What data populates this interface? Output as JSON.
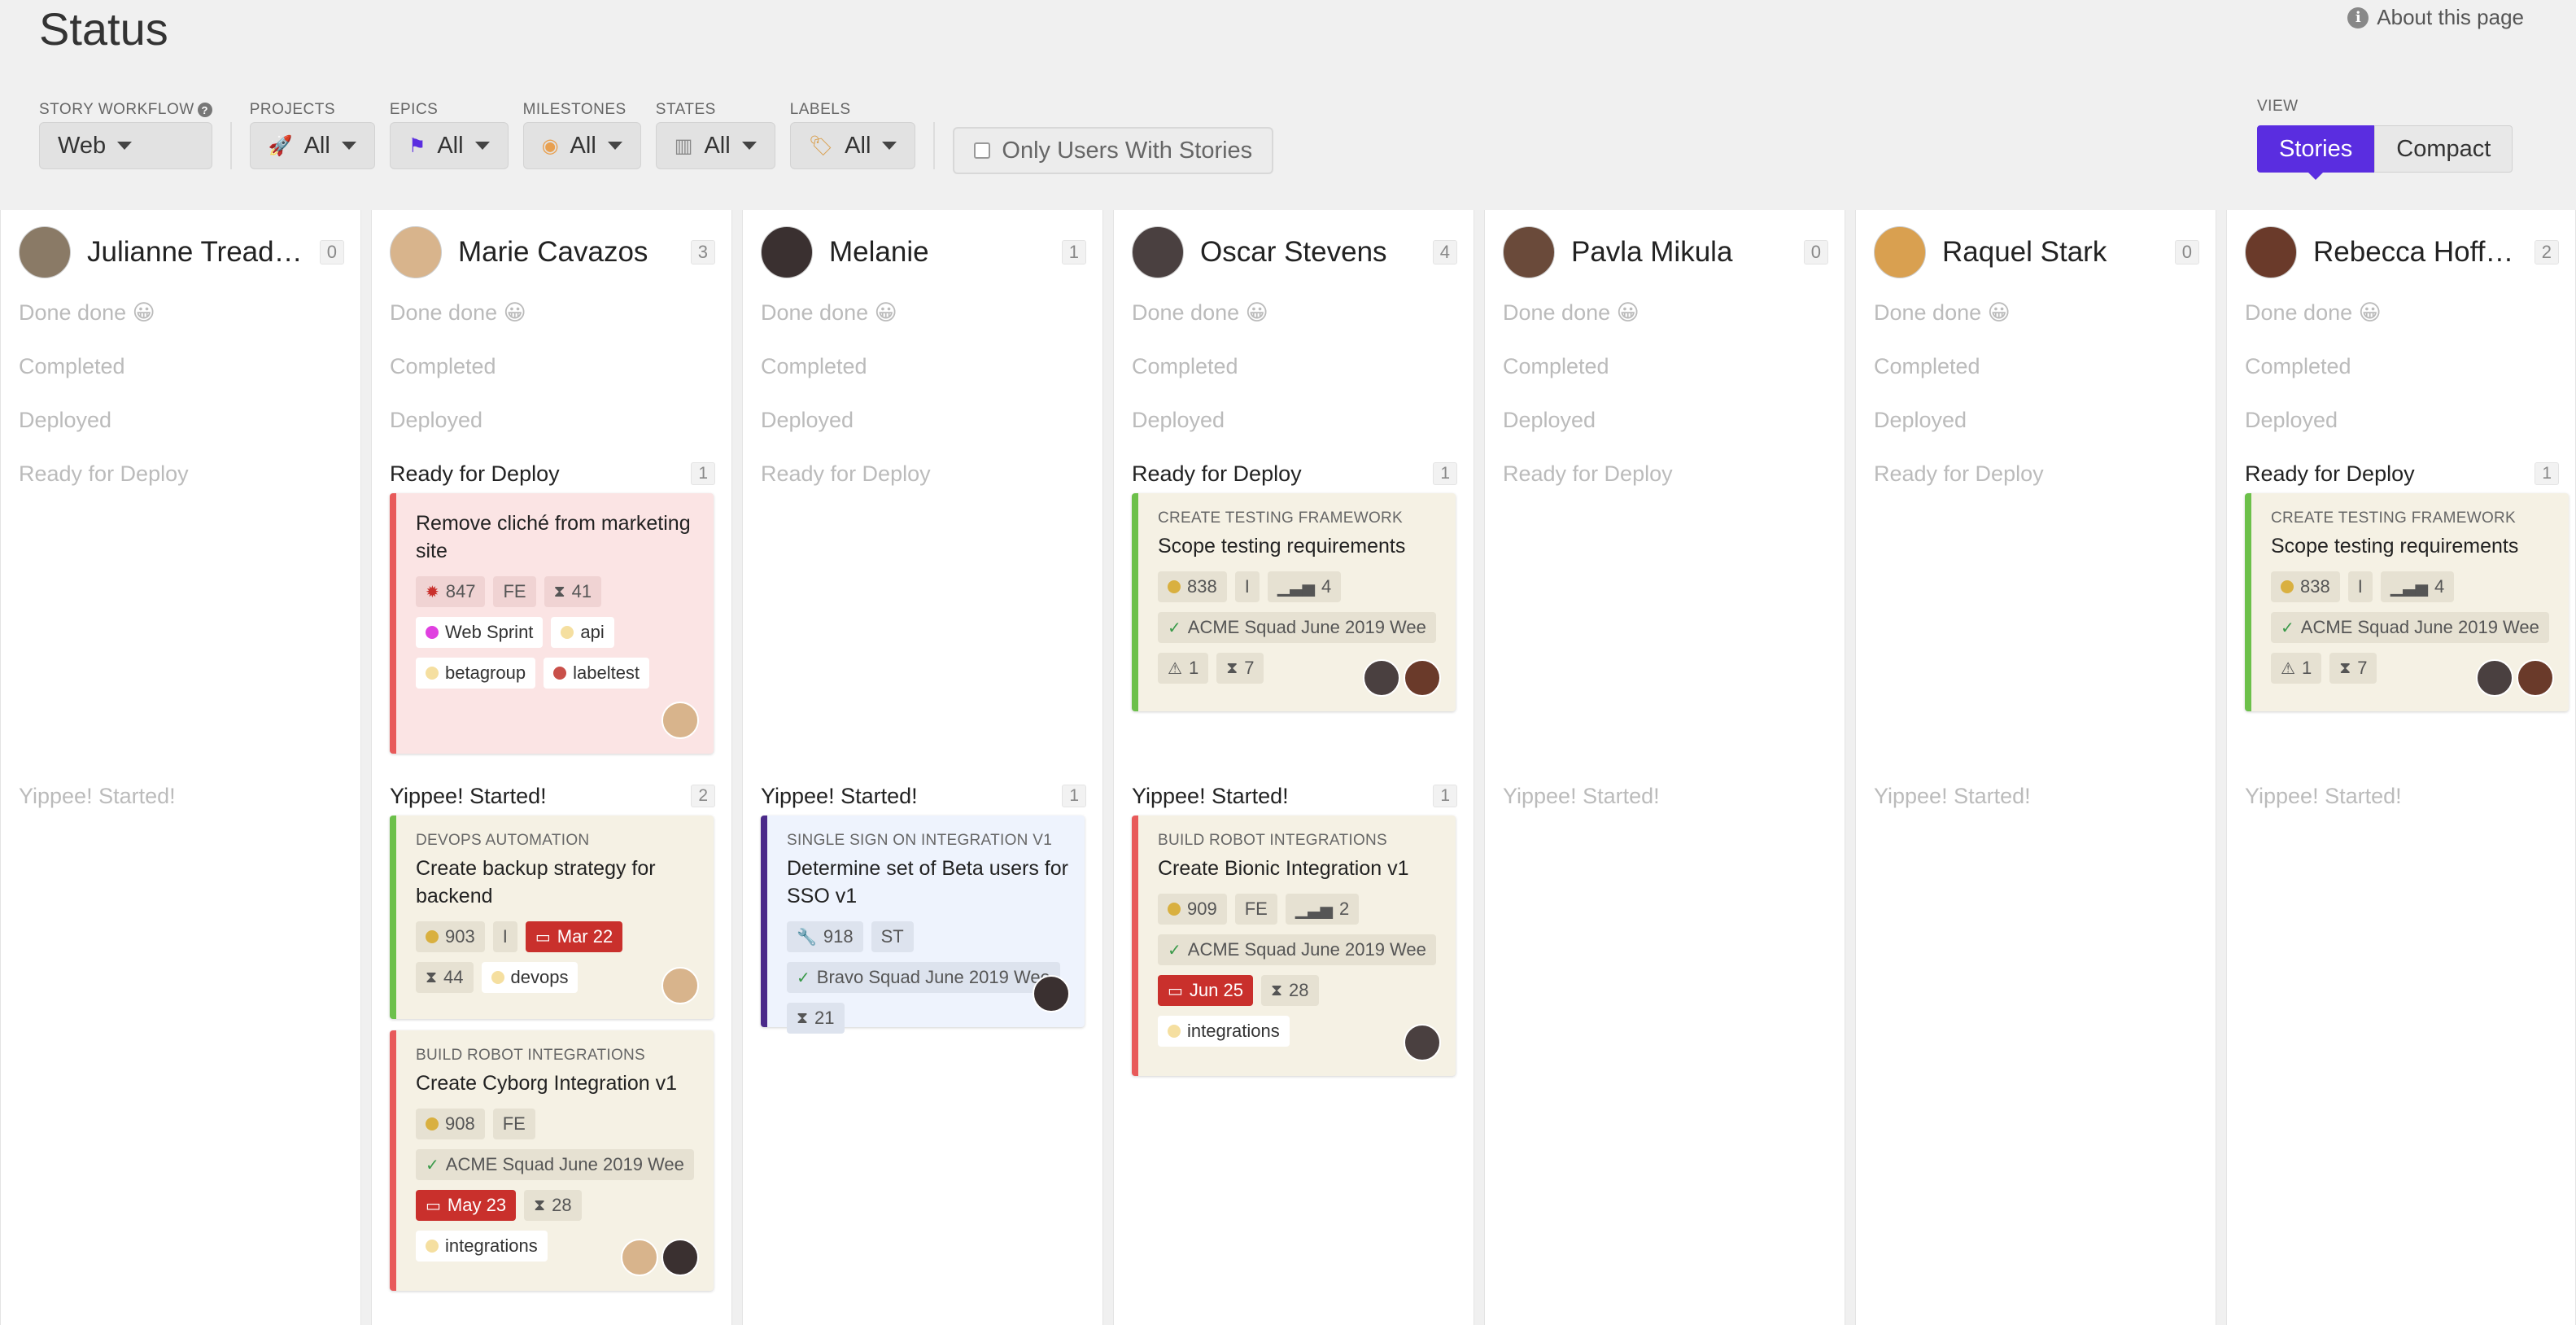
{
  "page": {
    "title": "Status",
    "about": "About this page"
  },
  "filters": {
    "story_workflow": {
      "label": "STORY WORKFLOW",
      "value": "Web"
    },
    "projects": {
      "label": "PROJECTS",
      "value": "All"
    },
    "epics": {
      "label": "EPICS",
      "value": "All"
    },
    "milestones": {
      "label": "MILESTONES",
      "value": "All"
    },
    "states": {
      "label": "STATES",
      "value": "All"
    },
    "labels": {
      "label": "LABELS",
      "value": "All"
    },
    "only_users": "Only Users With Stories"
  },
  "view": {
    "label": "VIEW",
    "options": [
      "Stories",
      "Compact"
    ],
    "selected": "Stories"
  },
  "states": [
    "Done done 😀",
    "Completed",
    "Deployed",
    "Ready for Deploy",
    "Yippee! Started!"
  ],
  "columns": [
    {
      "name": "Julianne Treadw...",
      "count": "0"
    },
    {
      "name": "Marie Cavazos",
      "count": "3",
      "ready_count": "1",
      "started_count": "2"
    },
    {
      "name": "Melanie",
      "count": "1",
      "started_count": "1"
    },
    {
      "name": "Oscar Stevens",
      "count": "4",
      "ready_count": "1",
      "started_count": "1"
    },
    {
      "name": "Pavla Mikula",
      "count": "0"
    },
    {
      "name": "Raquel Stark",
      "count": "0"
    },
    {
      "name": "Rebecca Hoffman",
      "count": "2",
      "ready_count": "1"
    }
  ],
  "cards": {
    "marie_ready": {
      "title": "Remove cliché from marketing site",
      "id": "847",
      "type": "FE",
      "estimate": "41",
      "labels": [
        "Web Sprint",
        "api",
        "betagroup",
        "labeltest"
      ]
    },
    "marie_started_1": {
      "epic": "DEVOPS AUTOMATION",
      "title": "Create backup strategy for backend",
      "id": "903",
      "type": "I",
      "date": "Mar 22",
      "estimate": "44",
      "labels": [
        "devops"
      ]
    },
    "marie_started_2": {
      "epic": "BUILD ROBOT INTEGRATIONS",
      "title": "Create Cyborg Integration v1",
      "id": "908",
      "type": "FE",
      "milestone": "ACME Squad June 2019 Wee",
      "date": "May 23",
      "estimate": "28",
      "labels": [
        "integrations"
      ]
    },
    "melanie_started": {
      "epic": "SINGLE SIGN ON INTEGRATION V1",
      "title": "Determine set of Beta users for SSO v1",
      "id": "918",
      "type": "ST",
      "milestone": "Bravo Squad June 2019 Wee",
      "estimate": "21"
    },
    "oscar_ready": {
      "epic": "CREATE TESTING FRAMEWORK",
      "title": "Scope testing requirements",
      "id": "838",
      "type": "I",
      "points": "4",
      "milestone": "ACME Squad June 2019 Wee",
      "blockers": "1",
      "estimate": "7"
    },
    "oscar_started": {
      "epic": "BUILD ROBOT INTEGRATIONS",
      "title": "Create Bionic Integration v1",
      "id": "909",
      "type": "FE",
      "points": "2",
      "milestone": "ACME Squad June 2019 Wee",
      "date": "Jun 25",
      "estimate": "28",
      "labels": [
        "integrations"
      ]
    },
    "rebecca_ready": {
      "epic": "CREATE TESTING FRAMEWORK",
      "title": "Scope testing requirements",
      "id": "838",
      "type": "I",
      "points": "4",
      "milestone": "ACME Squad June 2019 Wee",
      "blockers": "1",
      "estimate": "7"
    }
  },
  "colors": {
    "accent": "#5a2de0",
    "date_badge": "#c9302c",
    "label_web_sprint": "#e040e0",
    "label_api": "#f5dfa0",
    "label_betagroup": "#f5dfa0",
    "label_labeltest": "#c9504a",
    "label_devops": "#f5dfa0",
    "label_integrations": "#f5dfa0",
    "avatar_julianne": "#8a7a66",
    "avatar_marie": "#d8b48c",
    "avatar_melanie": "#3a3030",
    "avatar_oscar": "#4a4040",
    "avatar_pavla": "#6a4a3a",
    "avatar_raquel": "#d9a050",
    "avatar_rebecca": "#6a3a2a"
  }
}
